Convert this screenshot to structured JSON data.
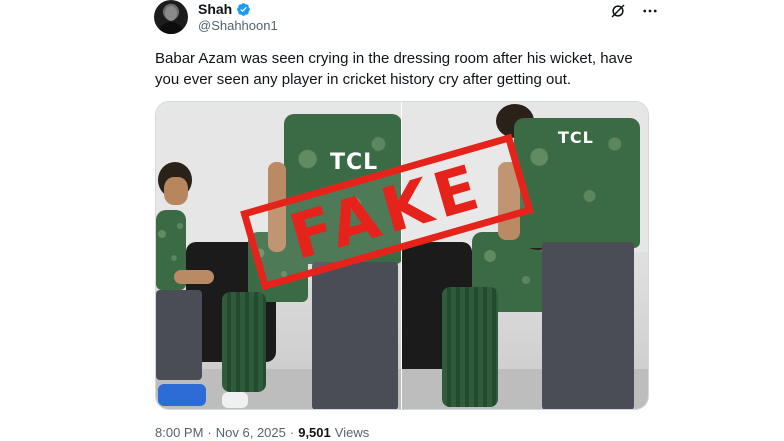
{
  "author": {
    "display_name": "Shah",
    "handle": "@Shahhoon1",
    "verified_icon": "verified-badge-icon",
    "verified_color": "#1d9bf0"
  },
  "actions": {
    "grok_icon": "grok-icon",
    "more_icon": "more-options-icon"
  },
  "tweet": {
    "text": "Babar Azam was seen crying in the dressing room after his wicket, have you ever seen any player in cricket history cry after getting out."
  },
  "media": {
    "jersey_text_left": "TCL",
    "jersey_text_right": "TCL",
    "stamp_text": "FAKE",
    "stamp_color": "#e5231b"
  },
  "meta": {
    "time": "8:00 PM",
    "separator": "·",
    "date": "Nov 6, 2025",
    "views_count": "9,501",
    "views_label": "Views"
  }
}
